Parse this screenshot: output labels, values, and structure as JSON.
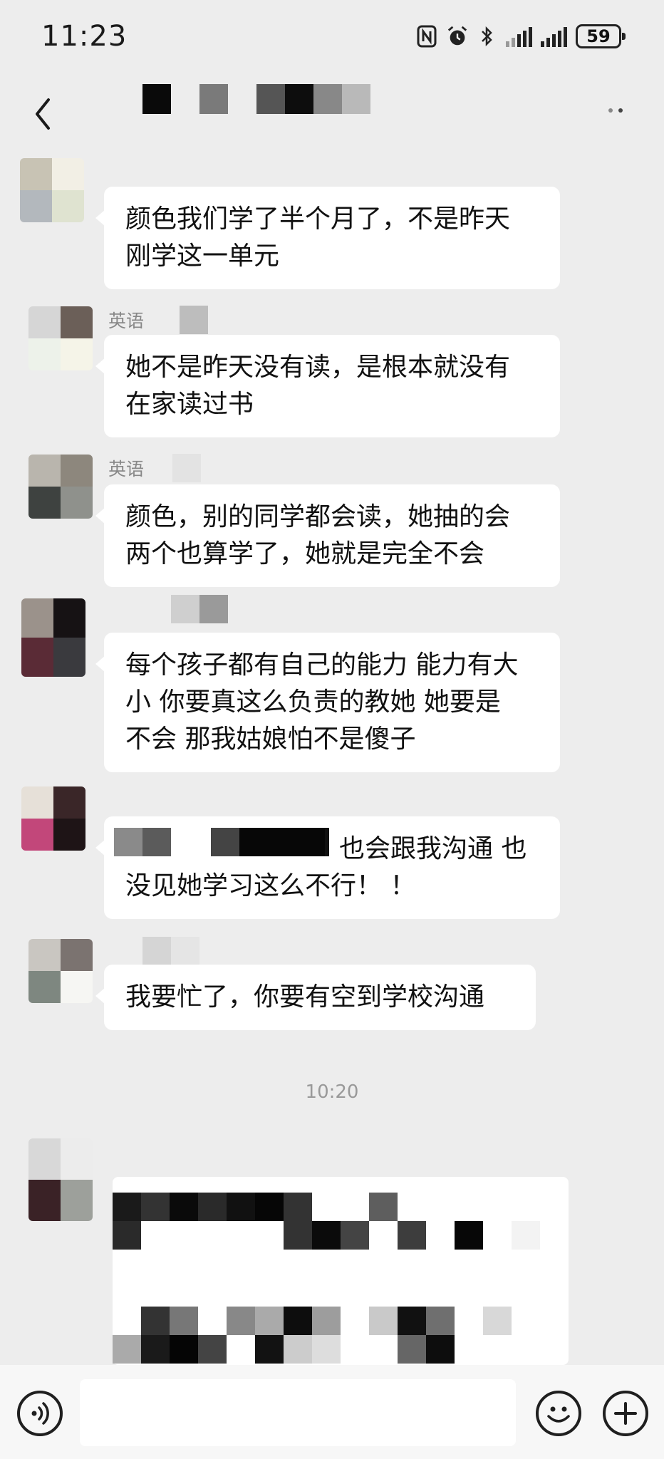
{
  "status_bar": {
    "time": "11:23",
    "battery": "59",
    "icons": [
      "nfc-icon",
      "alarm-icon",
      "bluetooth-icon",
      "signal-icon",
      "signal-icon",
      "battery-icon"
    ]
  },
  "nav": {
    "back_icon": "chevron-left-icon",
    "more_icon": "more-dots-icon",
    "title_redacted": true
  },
  "messages": [
    {
      "sender": "",
      "lines": [
        "颜色我们学了半个月了，不是昨天",
        "刚学这一单元"
      ]
    },
    {
      "sender": "英语",
      "lines": [
        "她不是昨天没有读，是根本就没有",
        "在家读过书"
      ]
    },
    {
      "sender": "英语",
      "lines": [
        "颜色，别的同学都会读，她抽的会",
        "两个也算学了，她就是完全不会"
      ]
    },
    {
      "sender": "",
      "lines": [
        "每个孩子都有自己的能力 能力有大",
        "小  你要真这么负责的教她  她要是",
        "不会  那我姑娘怕不是傻子"
      ]
    },
    {
      "sender": "",
      "lines": [
        "也会跟我沟通  也",
        "没见她学习这么不行！ ！"
      ]
    },
    {
      "sender": "",
      "lines": [
        "我要忙了，你要有空到学校沟通"
      ]
    }
  ],
  "timestamp": "10:20",
  "input_bar": {
    "voice_icon": "voice-icon",
    "emoji_icon": "emoji-icon",
    "plus_icon": "plus-icon"
  },
  "colors": {
    "background": "#ededed",
    "bubble": "#ffffff",
    "text": "#111111",
    "muted": "#888888"
  }
}
